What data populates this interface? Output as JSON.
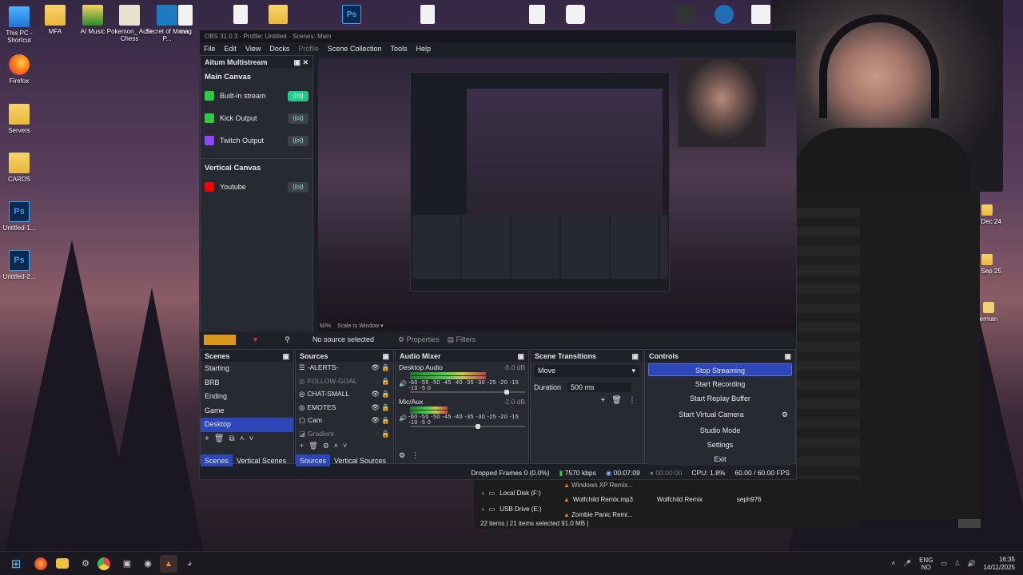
{
  "desktop": {
    "icons": [
      {
        "label": "This PC - Shortcut",
        "icon": "monitor-icon"
      },
      {
        "label": "Firefox",
        "icon": "firefox-icon"
      },
      {
        "label": "Servers",
        "icon": "folder-icon"
      },
      {
        "label": "CARDS",
        "icon": "folder-icon"
      },
      {
        "label": "Untitled-1...",
        "icon": "photoshop-icon"
      },
      {
        "label": "Untitled-2...",
        "icon": "photoshop-icon"
      }
    ],
    "top_icons": [
      {
        "label": "MFA"
      },
      {
        "label": "AI Music"
      },
      {
        "label": "Pokemon_ Auto Chess"
      },
      {
        "label": "Secret of Mana P..."
      },
      {
        "label": "mag"
      }
    ],
    "right_labels": [
      "UI Dec 24",
      "UI Sep 25",
      "erman"
    ]
  },
  "obs": {
    "title": "OBS 31.0.3 - Profile: Untitled - Scenes: Main",
    "menu": [
      "File",
      "Edit",
      "View",
      "Docks",
      "Profile",
      "Scene Collection",
      "Tools",
      "Help"
    ],
    "multistream": {
      "title": "Aitum Multistream",
      "main_canvas": "Main Canvas",
      "outputs": [
        {
          "label": "Built-in stream",
          "color": "#2ecc40",
          "on": true
        },
        {
          "label": "Kick Output",
          "color": "#2ecc40",
          "on": false
        },
        {
          "label": "Twitch Output",
          "color": "#9146ff",
          "on": false
        }
      ],
      "vertical_canvas": "Vertical Canvas",
      "vertical_outputs": [
        {
          "label": "Youtube",
          "color": "#ff0000",
          "on": false
        }
      ]
    },
    "preview": {
      "zoom": "60%",
      "scale": "Scale to Window"
    },
    "source_bar": {
      "status": "No source selected",
      "properties": "Properties",
      "filters": "Filters"
    },
    "scenes": {
      "title": "Scenes",
      "items": [
        "Starting",
        "BRB",
        "Ending",
        "Game",
        "Desktop"
      ],
      "selected": "Desktop",
      "tabs": [
        "Scenes",
        "Vertical Scenes"
      ]
    },
    "sources": {
      "title": "Sources",
      "items": [
        "-ALERTS-",
        "FOLLOW-GOAL",
        "CHAT-SMALL",
        "EMOTES",
        "Cam",
        "Gradient"
      ],
      "tabs": [
        "Sources",
        "Vertical Sources"
      ]
    },
    "mixer": {
      "title": "Audio Mixer",
      "channels": [
        {
          "name": "Desktop Audio",
          "db": "-8.0 dB",
          "level": 0.82
        },
        {
          "name": "Mic/Aux",
          "db": "-2.0 dB",
          "level": 0.57
        }
      ],
      "scale": "-60 -55 -50 -45 -40 -35 -30 -25 -20 -15 -10 -5 0"
    },
    "transitions": {
      "title": "Scene Transitions",
      "selected": "Move",
      "duration_label": "Duration",
      "duration": "500 ms"
    },
    "controls": {
      "title": "Controls",
      "buttons": [
        "Stop Streaming",
        "Start Recording",
        "Start Replay Buffer",
        "Start Virtual Camera",
        "Studio Mode",
        "Settings",
        "Exit"
      ]
    },
    "status": {
      "dropped": "Dropped Frames 0 (0.0%)",
      "kbps": "7570 kbps",
      "stream_time": "00:07:09",
      "rec_time": "00:00:00",
      "cpu": "CPU: 1.8%",
      "fps": "60.00 / 60.00 FPS"
    }
  },
  "explorer": {
    "drives": [
      "Local Disk (F:)",
      "USB Drive (E:)"
    ],
    "files": [
      {
        "name": "Windows XP Remix...",
        "title": "",
        "artist": ""
      },
      {
        "name": "Wolfchild Remix.mp3",
        "title": "Wolfchild Remix",
        "artist": "seph976"
      },
      {
        "name": "Zombie Panic Remi...",
        "title": "",
        "artist": ""
      }
    ],
    "status": "22 items | 21 items selected 91.0 MB |"
  },
  "taskbar": {
    "lang1": "ENG",
    "lang2": "NO",
    "time": "16:35",
    "date": "14/11/2025"
  }
}
